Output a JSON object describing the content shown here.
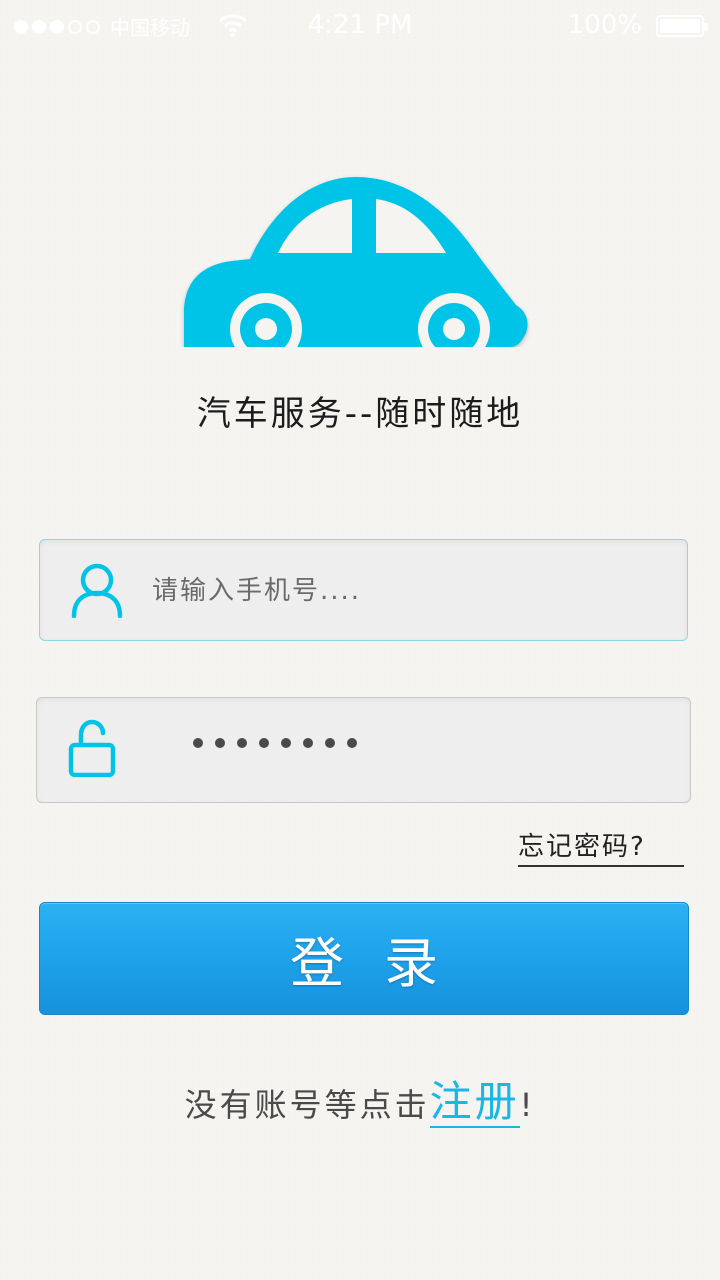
{
  "status_bar": {
    "carrier": "中国移动",
    "time": "4:21 PM",
    "battery": "100%"
  },
  "brand": {
    "logo_icon": "car-icon",
    "slogan": "汽车服务--随时随地",
    "accent_color": "#00c3e8"
  },
  "login_form": {
    "phone_placeholder": "请输入手机号....",
    "phone_icon": "user-icon",
    "password_icon": "unlock-icon",
    "password_masked": "••••••••",
    "forgot_label": "忘记密码?",
    "submit_label": "登录",
    "submit_color": "#1ea2ea"
  },
  "register": {
    "prefix": "没有账号等点击",
    "link_label": "注册",
    "suffix": "!"
  }
}
